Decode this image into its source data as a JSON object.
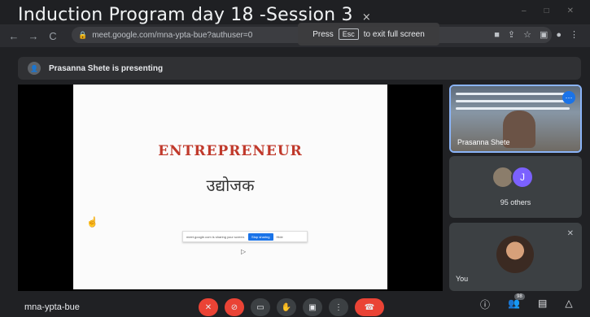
{
  "overlay": {
    "title": "Induction Program day 18 -Session 3",
    "close_glyph": "×"
  },
  "browser": {
    "back": "←",
    "forward": "→",
    "reload": "C",
    "url": "meet.google.com/mna-ypta-bue?authuser=0",
    "fullscreen_press": "Press",
    "fullscreen_key": "Esc",
    "fullscreen_text": "to exit full screen"
  },
  "presenting": {
    "text": "Prasanna Shete is presenting"
  },
  "slide": {
    "title": "ENTREPRENEUR",
    "subtitle": "उद्योजक",
    "share_text": "meet.google.com is sharing your screen.",
    "stop_label": "Stop sharing",
    "hide_label": "Hide"
  },
  "tiles": {
    "presenter_name": "Prasanna Shete",
    "others_initial": "J",
    "others_count": "95 others",
    "self_label": "You"
  },
  "bottom": {
    "meeting_code": "mna-ypta-bue",
    "participants_badge": "98"
  }
}
